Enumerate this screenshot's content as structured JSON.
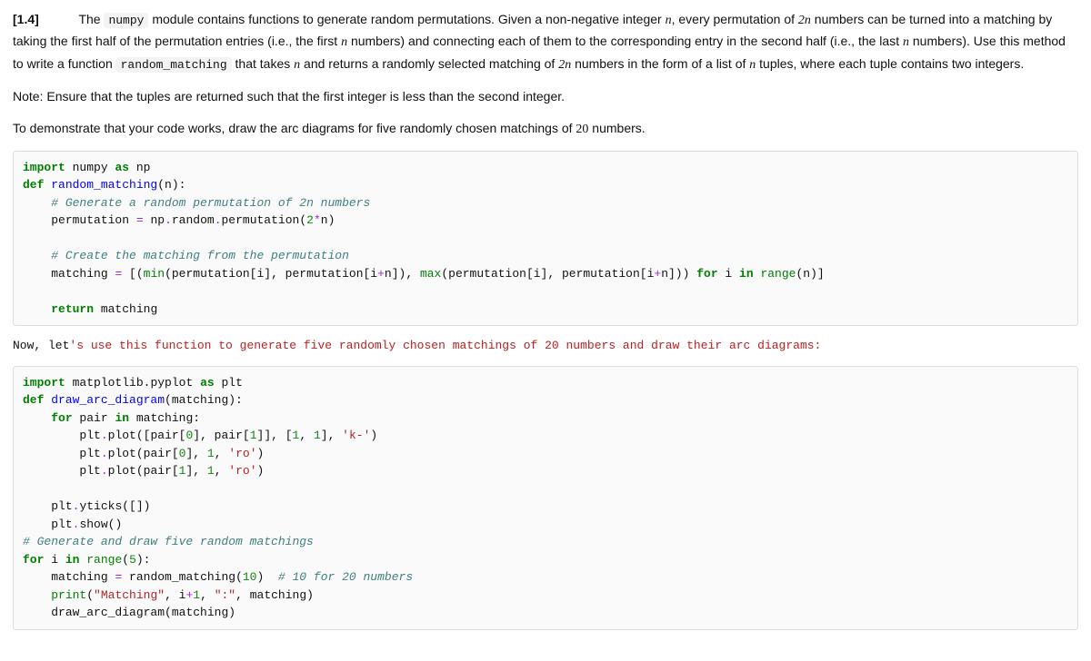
{
  "question": {
    "label": "[1.4]",
    "p1_a": "The ",
    "p1_code1": "numpy",
    "p1_b": " module contains functions to generate random permutations. Given a non-negative integer ",
    "p1_var1": "n",
    "p1_c": ", every permutation of ",
    "p1_var2": "2n",
    "p1_d": " numbers can be turned into a matching by taking the first half of the permutation entries (i.e., the first ",
    "p1_var3": "n",
    "p1_e": " numbers) and connecting each of them to the corresponding entry in the second half (i.e., the last ",
    "p1_var4": "n",
    "p1_f": " numbers). Use this method to write a function ",
    "p1_code2": "random_matching",
    "p1_g": " that takes ",
    "p1_var5": "n",
    "p1_h": " and returns a randomly selected matching of ",
    "p1_var6": "2n",
    "p1_i": " numbers in the form of a list of ",
    "p1_var7": "n",
    "p1_j": " tuples, where each tuple contains two integers.",
    "note": "Note: Ensure that the tuples are returned such that the first integer is less than the second integer.",
    "demo_a": "To demonstrate that your code works, draw the arc diagrams for five randomly chosen matchings of ",
    "demo_num": "20",
    "demo_b": " numbers."
  },
  "code1": {
    "l1": {
      "kw1": "import",
      "sp1": " ",
      "id1": "numpy",
      "sp2": " ",
      "kw2": "as",
      "sp3": " ",
      "id2": "np"
    },
    "l2": {
      "kw1": "def",
      "sp1": " ",
      "fn": "random_matching",
      "rest": "(n):"
    },
    "l3": {
      "indent": "    ",
      "cm": "# Generate a random permutation of 2n numbers"
    },
    "l4": {
      "indent": "    ",
      "a": "permutation ",
      "op": "=",
      "b": " np",
      "dot1": ".",
      "c": "random",
      "dot2": ".",
      "d": "permutation",
      "e": "(",
      "num": "2",
      "star": "*",
      "f": "n)"
    },
    "l5": {
      "blank": ""
    },
    "l6": {
      "indent": "    ",
      "cm": "# Create the matching from the permutation"
    },
    "l7": {
      "indent": "    ",
      "a": "matching ",
      "op": "=",
      "b": " [(",
      "min": "min",
      "c": "(permutation[i], permutation[i",
      "plus1": "+",
      "d": "n]), ",
      "max": "max",
      "e": "(permutation[i], permutation[i",
      "plus2": "+",
      "f": "n])) ",
      "for": "for",
      "g": " i ",
      "in": "in",
      "h": " ",
      "range": "range",
      "i2": "(n)]"
    },
    "l8": {
      "blank": ""
    },
    "l9": {
      "indent": "    ",
      "kw": "return",
      "rest": " matching"
    }
  },
  "intermediate": {
    "a": "Now, let",
    "str": "'s use this function to generate five randomly chosen matchings of 20 numbers and draw their arc diagrams:"
  },
  "code2": {
    "l1": {
      "kw1": "import",
      "sp1": " ",
      "id1": "matplotlib.pyplot",
      "sp2": " ",
      "kw2": "as",
      "sp3": " ",
      "id2": "plt"
    },
    "l2": {
      "kw1": "def",
      "sp1": " ",
      "fn": "draw_arc_diagram",
      "rest": "(matching):"
    },
    "l3": {
      "indent": "    ",
      "for": "for",
      "a": " pair ",
      "in": "in",
      "b": " matching:"
    },
    "l4": {
      "indent": "        ",
      "a": "plt",
      "dot": ".",
      "b": "plot",
      "c": "([pair[",
      "n0a": "0",
      "d": "], pair[",
      "n1a": "1",
      "e": "]], [",
      "n1b": "1",
      "f": ", ",
      "n1c": "1",
      "g": "], ",
      "s": "'k-'",
      "h": ")"
    },
    "l5": {
      "indent": "        ",
      "a": "plt",
      "dot": ".",
      "b": "plot",
      "c": "(pair[",
      "n0": "0",
      "d": "], ",
      "n1": "1",
      "e": ", ",
      "s": "'ro'",
      "f": ")"
    },
    "l6": {
      "indent": "        ",
      "a": "plt",
      "dot": ".",
      "b": "plot",
      "c": "(pair[",
      "n1a": "1",
      "d": "], ",
      "n1b": "1",
      "e": ", ",
      "s": "'ro'",
      "f": ")"
    },
    "l7": {
      "blank": ""
    },
    "l8": {
      "indent": "    ",
      "a": "plt",
      "dot": ".",
      "b": "yticks",
      "c": "([])"
    },
    "l9": {
      "indent": "    ",
      "a": "plt",
      "dot": ".",
      "b": "show",
      "c": "()"
    },
    "l10": {
      "cm": "# Generate and draw five random matchings"
    },
    "l11": {
      "for": "for",
      "a": " i ",
      "in": "in",
      "b": " ",
      "range": "range",
      "c": "(",
      "n": "5",
      "d": "):"
    },
    "l12": {
      "indent": "    ",
      "a": "matching ",
      "op": "=",
      "b": " random_matching(",
      "n": "10",
      "c": ")  ",
      "cm": "# 10 for 20 numbers"
    },
    "l13": {
      "indent": "    ",
      "print": "print",
      "a": "(",
      "s1": "\"Matching\"",
      "b": ", i",
      "plus": "+",
      "n": "1",
      "c": ", ",
      "s2": "\":\"",
      "d": ", matching)"
    },
    "l14": {
      "indent": "    ",
      "a": "draw_arc_diagram(matching)"
    }
  }
}
